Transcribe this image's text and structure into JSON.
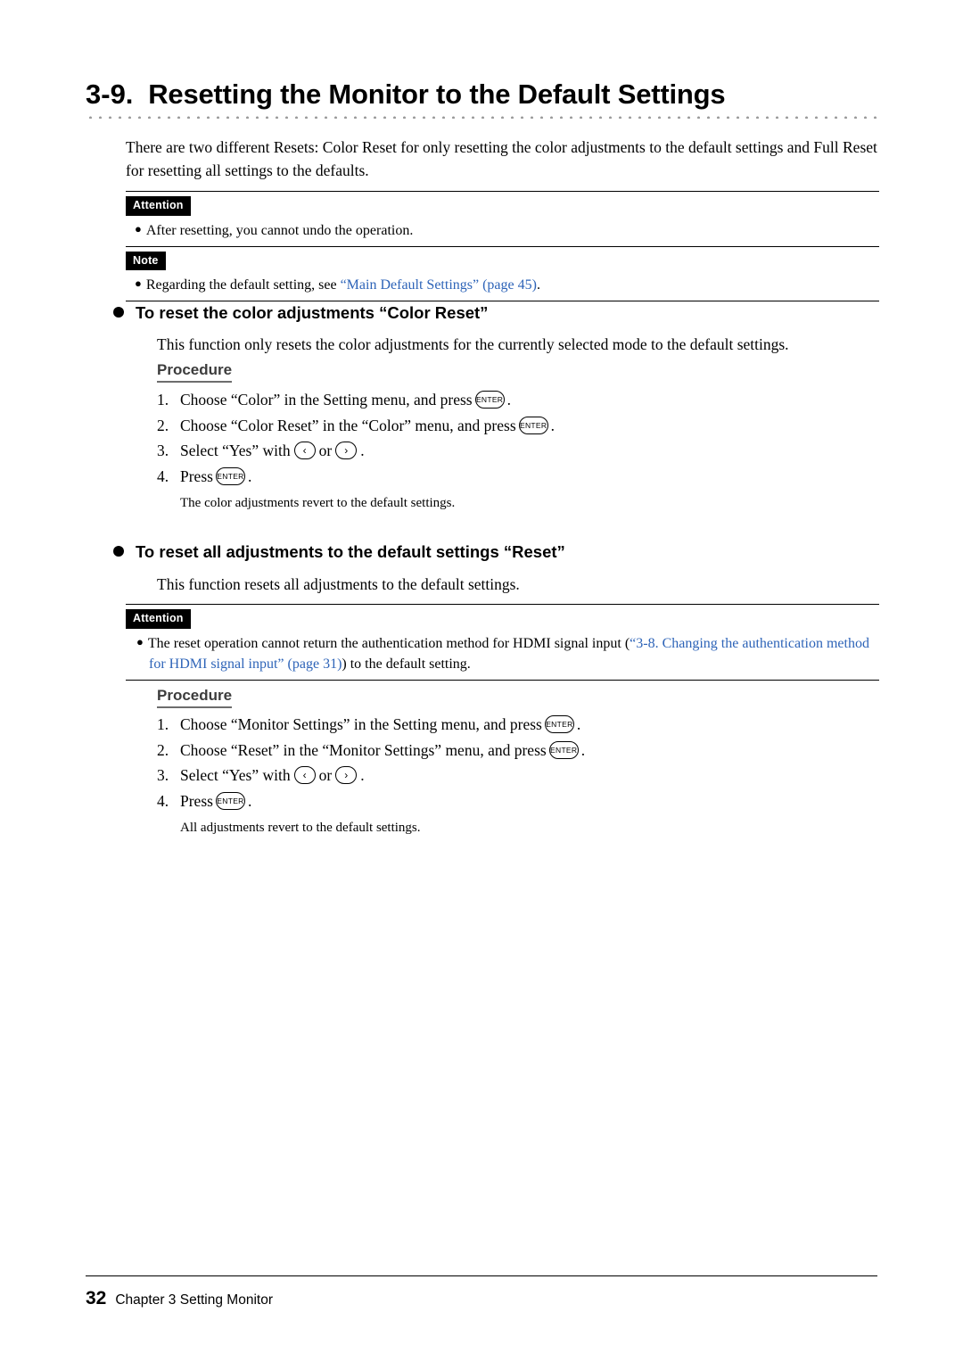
{
  "title": {
    "number": "3-9.",
    "text": "Resetting the Monitor to the Default Settings"
  },
  "intro": "There are two different Resets: Color Reset for only resetting the color adjustments to the default settings and Full Reset for resetting all settings to the defaults.",
  "notice_top": {
    "attention_tag": "Attention",
    "attention_text": "After resetting, you cannot undo the operation.",
    "note_tag": "Note",
    "note_text_before": "Regarding the default setting, see ",
    "note_link": "“Main Default Settings” (page 45)",
    "note_text_after": "."
  },
  "section1": {
    "heading": "To reset the color adjustments “Color Reset”",
    "description": "This function only resets the color adjustments for the currently selected mode to the default settings.",
    "procedure_label": "Procedure",
    "steps": [
      {
        "no": "1.",
        "pre": "Choose “Color” in the Setting menu, and press",
        "key": "ENTER",
        "post": "."
      },
      {
        "no": "2.",
        "pre": "Choose “Color Reset” in the “Color” menu, and press",
        "key": "ENTER",
        "post": "."
      },
      {
        "no": "3.",
        "pre": "Select “Yes” with",
        "key_left": "‹",
        "mid": "or",
        "key_right": "›",
        "post": "."
      },
      {
        "no": "4.",
        "pre": "Press",
        "key": "ENTER",
        "post": "."
      }
    ],
    "result": "The color adjustments revert to the default settings."
  },
  "section2": {
    "heading": "To reset all adjustments to the default settings “Reset”",
    "description": "This function resets all adjustments to the default settings.",
    "attention_tag": "Attention",
    "attention_text_before": "The reset operation cannot return the authentication method for HDMI signal input (",
    "attention_link": "“3-8. Changing the authentication method for HDMI signal input” (page 31)",
    "attention_text_after": ") to the default setting.",
    "procedure_label": "Procedure",
    "steps": [
      {
        "no": "1.",
        "pre": "Choose “Monitor Settings” in the Setting menu, and press",
        "key": "ENTER",
        "post": "."
      },
      {
        "no": "2.",
        "pre": "Choose “Reset” in the “Monitor Settings” menu, and press",
        "key": "ENTER",
        "post": "."
      },
      {
        "no": "3.",
        "pre": "Select “Yes” with",
        "key_left": "‹",
        "mid": "or",
        "key_right": "›",
        "post": "."
      },
      {
        "no": "4.",
        "pre": "Press",
        "key": "ENTER",
        "post": "."
      }
    ],
    "result": "All adjustments revert to the default settings."
  },
  "footer": {
    "page_number": "32",
    "chapter": "Chapter 3 Setting Monitor"
  },
  "colors": {
    "link": "#2e64b8",
    "tag_background": "#000000",
    "procedure_label": "#3c3c3c"
  }
}
